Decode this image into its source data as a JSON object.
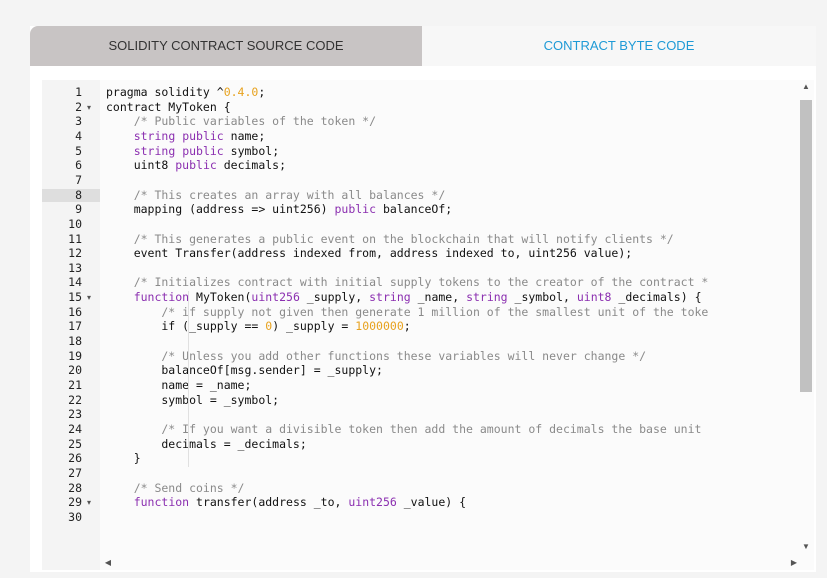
{
  "tabs": {
    "source_label": "SOLIDITY CONTRACT SOURCE CODE",
    "bytecode_label": "CONTRACT BYTE CODE"
  },
  "editor": {
    "lines": [
      {
        "n": "1",
        "fold": false,
        "segs": [
          [
            "pragma solidity ^",
            ""
          ],
          [
            "0.4.0",
            "num"
          ],
          [
            ";",
            ""
          ]
        ]
      },
      {
        "n": "2",
        "fold": true,
        "segs": [
          [
            "contract MyToken {",
            ""
          ]
        ]
      },
      {
        "n": "3",
        "fold": false,
        "segs": [
          [
            "    /* Public variables of the token */",
            "com"
          ]
        ]
      },
      {
        "n": "4",
        "fold": false,
        "segs": [
          [
            "    ",
            ""
          ],
          [
            "string public",
            ""
          ],
          [
            " name;",
            ""
          ]
        ]
      },
      {
        "n": "5",
        "fold": false,
        "segs": [
          [
            "    ",
            ""
          ],
          [
            "string public",
            ""
          ],
          [
            " symbol;",
            ""
          ]
        ]
      },
      {
        "n": "6",
        "fold": false,
        "segs": [
          [
            "    uint8 ",
            ""
          ],
          [
            "public",
            ""
          ],
          [
            " decimals;",
            ""
          ]
        ]
      },
      {
        "n": "7",
        "fold": false,
        "segs": []
      },
      {
        "n": "8",
        "fold": false,
        "hl": true,
        "segs": [
          [
            "    /* This creates an array with all balances */",
            "com"
          ]
        ]
      },
      {
        "n": "9",
        "fold": false,
        "segs": [
          [
            "    mapping (address => uint256) ",
            ""
          ],
          [
            "public",
            ""
          ],
          [
            " balanceOf;",
            ""
          ]
        ]
      },
      {
        "n": "10",
        "fold": false,
        "segs": []
      },
      {
        "n": "11",
        "fold": false,
        "segs": [
          [
            "    /* This generates a public event on the blockchain that will notify clients */",
            "com"
          ]
        ]
      },
      {
        "n": "12",
        "fold": false,
        "segs": [
          [
            "    event Transfer(address indexed from, address indexed to, uint256 value);",
            ""
          ]
        ]
      },
      {
        "n": "13",
        "fold": false,
        "segs": []
      },
      {
        "n": "14",
        "fold": false,
        "segs": [
          [
            "    /* Initializes contract with initial supply tokens to the creator of the contract *",
            "com"
          ]
        ]
      },
      {
        "n": "15",
        "fold": true,
        "segs": [
          [
            "    function MyToken(uint256 _supply, string _name, string _symbol, uint8 _decimals) {",
            ""
          ]
        ]
      },
      {
        "n": "16",
        "fold": false,
        "segs": [
          [
            "        /* if supply not given then generate 1 million of the smallest unit of the toke",
            "com"
          ]
        ]
      },
      {
        "n": "17",
        "fold": false,
        "segs": [
          [
            "        if (_supply == ",
            ""
          ],
          [
            "0",
            "num"
          ],
          [
            ") _supply = ",
            ""
          ],
          [
            "1000000",
            "num"
          ],
          [
            ";",
            ""
          ]
        ]
      },
      {
        "n": "18",
        "fold": false,
        "segs": []
      },
      {
        "n": "19",
        "fold": false,
        "segs": [
          [
            "        /* Unless you add other functions these variables will never change */",
            "com"
          ]
        ]
      },
      {
        "n": "20",
        "fold": false,
        "segs": [
          [
            "        balanceOf[msg.sender] = _supply;",
            ""
          ]
        ]
      },
      {
        "n": "21",
        "fold": false,
        "segs": [
          [
            "        name = _name;",
            ""
          ]
        ]
      },
      {
        "n": "22",
        "fold": false,
        "segs": [
          [
            "        symbol = _symbol;",
            ""
          ]
        ]
      },
      {
        "n": "23",
        "fold": false,
        "segs": []
      },
      {
        "n": "24",
        "fold": false,
        "segs": [
          [
            "        /* If you want a divisible token then add the amount of decimals the base unit",
            "com"
          ]
        ]
      },
      {
        "n": "25",
        "fold": false,
        "segs": [
          [
            "        decimals = _decimals;",
            ""
          ]
        ]
      },
      {
        "n": "26",
        "fold": false,
        "segs": [
          [
            "    }",
            ""
          ]
        ]
      },
      {
        "n": "27",
        "fold": false,
        "segs": []
      },
      {
        "n": "28",
        "fold": false,
        "segs": [
          [
            "    /* Send coins */",
            "com"
          ]
        ]
      },
      {
        "n": "29",
        "fold": true,
        "segs": [
          [
            "    function transfer(address _to, uint256 _value) {",
            ""
          ]
        ]
      },
      {
        "n": "30",
        "fold": false,
        "segs": []
      }
    ]
  },
  "colors": {
    "keyword": "#8b2fb0",
    "number": "#e7a21e",
    "comment": "#8a8a8a",
    "tab_active_bg": "#c8c4c4",
    "tab_link": "#1e9ad6"
  }
}
